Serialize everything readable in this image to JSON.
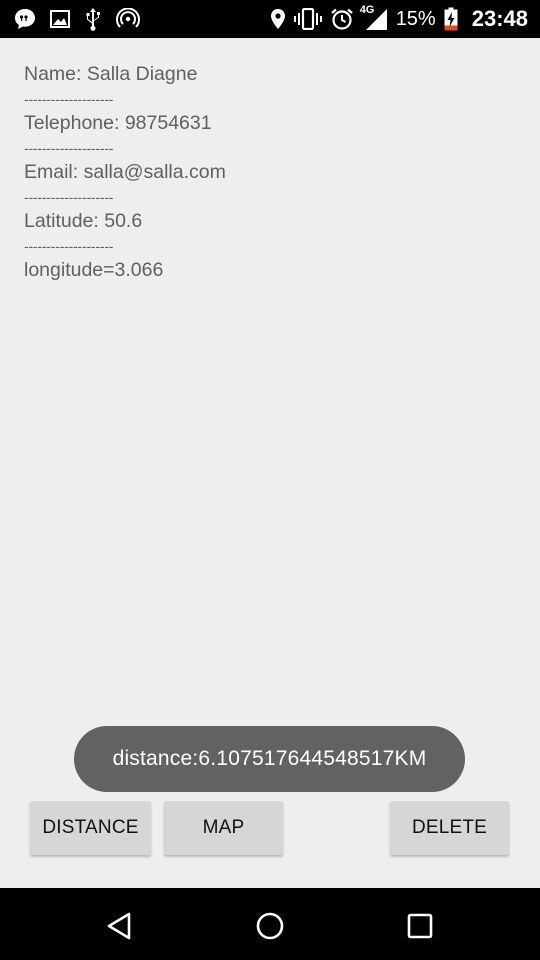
{
  "status_bar": {
    "left_icons": [
      "chat-bubble-icon",
      "image-icon",
      "usb-icon",
      "hotspot-icon"
    ],
    "right_icons": [
      "location-pin-icon",
      "vibrate-icon",
      "alarm-icon",
      "signal-4g-icon",
      "battery-charging-icon"
    ],
    "network_label": "4G",
    "battery_percent": "15%",
    "time": "23:48"
  },
  "contact": {
    "name_line": "Name: Salla Diagne",
    "separator": "--------------------",
    "telephone_line": "Telephone: 98754631",
    "email_line": "Email: salla@salla.com",
    "latitude_line": "Latitude: 50.6",
    "longitude_line": "longitude=3.066"
  },
  "toast": {
    "message": "distance:6.107517644548517KM"
  },
  "buttons": {
    "distance_label": "DISTANCE",
    "map_label": "MAP",
    "delete_label": "DELETE"
  },
  "nav_bar": {
    "icons": [
      "back-icon",
      "home-icon",
      "recents-icon"
    ]
  },
  "colors": {
    "status_bar_bg": "#000000",
    "screen_bg": "#eeeeee",
    "text": "#606060",
    "toast_bg": "#626262",
    "button_bg": "#d6d6d6",
    "battery_accent": "#e64a19"
  }
}
